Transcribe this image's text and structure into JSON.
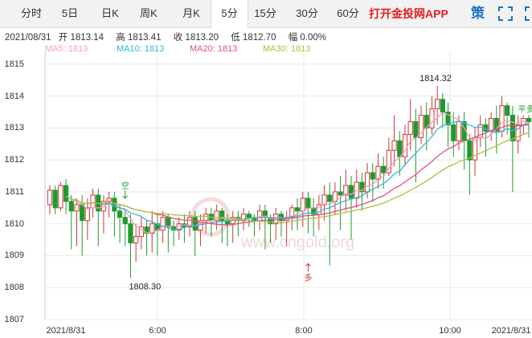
{
  "tabs": [
    {
      "label": "分时",
      "active": false
    },
    {
      "label": "5日",
      "active": false
    },
    {
      "label": "日K",
      "active": false
    },
    {
      "label": "周K",
      "active": false
    },
    {
      "label": "月K",
      "active": false
    },
    {
      "label": "5分",
      "active": true
    },
    {
      "label": "15分",
      "active": false
    },
    {
      "label": "30分",
      "active": false
    },
    {
      "label": "60分",
      "active": false
    }
  ],
  "app_link": "打开金投网APP",
  "tools": {
    "strategy_icon": "策",
    "fullscreen_icon": "expand-icon"
  },
  "ohlc": {
    "date": "2021/08/31",
    "open_label": "开",
    "open": "1813.14",
    "high_label": "高",
    "high": "1813.41",
    "close_label": "收",
    "close": "1813.20",
    "low_label": "低",
    "low": "1812.70",
    "amp_label": "幅",
    "amp": "0.00%"
  },
  "ma_legend": [
    {
      "label": "MA5: 1813",
      "color": "#f4a0b8"
    },
    {
      "label": "MA10: 1813",
      "color": "#36b7d8"
    },
    {
      "label": "MA20: 1813",
      "color": "#e0507a"
    },
    {
      "label": "MA30: 1813",
      "color": "#a9c23c"
    }
  ],
  "colors": {
    "up": "#d0373a",
    "down": "#1f9a2e",
    "grid": "#e9e9e9"
  },
  "watermark": "www.cngold.org",
  "chart_data": {
    "type": "candlestick",
    "title": "",
    "ylim": [
      1807,
      1815.3
    ],
    "y_ticks": [
      "1815",
      "1814",
      "1813",
      "1812",
      "1811",
      "1810",
      "1809",
      "1808",
      "1807"
    ],
    "x_ticks": [
      "2021/8/31",
      "6:00",
      "8:00",
      "10:00",
      "2021/8/31"
    ],
    "annotations": {
      "high": "1814.32",
      "low": "1808.30",
      "short_signal": "空",
      "long_signal": "多",
      "level_signal": "平多"
    },
    "candles": [
      [
        1810.6,
        1811.05,
        1810.3,
        1811.2
      ],
      [
        1811.05,
        1810.5,
        1810.3,
        1811.2
      ],
      [
        1810.5,
        1811.2,
        1810.4,
        1811.3
      ],
      [
        1811.2,
        1810.7,
        1810.3,
        1811.4
      ],
      [
        1810.7,
        1810.4,
        1809.2,
        1810.9
      ],
      [
        1810.4,
        1810.6,
        1809.3,
        1810.8
      ],
      [
        1810.6,
        1810.1,
        1809.0,
        1810.9
      ],
      [
        1810.1,
        1810.5,
        1809.5,
        1810.8
      ],
      [
        1810.5,
        1810.9,
        1810.2,
        1811.1
      ],
      [
        1810.9,
        1810.4,
        1809.3,
        1811.1
      ],
      [
        1810.4,
        1810.7,
        1809.7,
        1810.9
      ],
      [
        1810.7,
        1810.8,
        1810.2,
        1811.0
      ],
      [
        1810.8,
        1810.4,
        1809.6,
        1811.0
      ],
      [
        1810.4,
        1810.2,
        1809.4,
        1810.6
      ],
      [
        1810.2,
        1810.0,
        1809.3,
        1810.4
      ],
      [
        1810.0,
        1809.4,
        1808.3,
        1810.3
      ],
      [
        1809.4,
        1809.6,
        1808.8,
        1810.0
      ],
      [
        1809.6,
        1809.9,
        1809.2,
        1810.2
      ],
      [
        1809.9,
        1809.7,
        1809.0,
        1810.1
      ],
      [
        1809.7,
        1810.0,
        1809.1,
        1810.4
      ],
      [
        1810.0,
        1809.8,
        1809.0,
        1810.3
      ],
      [
        1809.8,
        1810.2,
        1809.4,
        1810.4
      ],
      [
        1810.2,
        1809.9,
        1809.1,
        1810.3
      ],
      [
        1809.9,
        1809.8,
        1809.3,
        1810.1
      ],
      [
        1809.8,
        1810.0,
        1809.5,
        1810.2
      ],
      [
        1810.0,
        1809.9,
        1809.4,
        1810.3
      ],
      [
        1809.9,
        1810.2,
        1809.6,
        1810.4
      ],
      [
        1810.2,
        1809.8,
        1809.0,
        1810.4
      ],
      [
        1809.8,
        1810.1,
        1809.3,
        1810.3
      ],
      [
        1810.1,
        1810.3,
        1809.7,
        1810.5
      ],
      [
        1810.3,
        1810.1,
        1809.6,
        1810.5
      ],
      [
        1810.1,
        1810.4,
        1809.8,
        1810.6
      ],
      [
        1810.4,
        1810.1,
        1809.4,
        1810.5
      ],
      [
        1810.1,
        1810.0,
        1809.3,
        1810.3
      ],
      [
        1810.0,
        1810.2,
        1809.4,
        1810.4
      ],
      [
        1810.2,
        1810.1,
        1809.6,
        1810.4
      ],
      [
        1810.1,
        1810.3,
        1809.8,
        1810.5
      ],
      [
        1810.3,
        1810.2,
        1809.9,
        1810.4
      ],
      [
        1810.2,
        1810.1,
        1809.6,
        1810.3
      ],
      [
        1810.1,
        1810.4,
        1809.8,
        1810.6
      ],
      [
        1810.4,
        1810.2,
        1809.2,
        1810.6
      ],
      [
        1810.2,
        1810.0,
        1809.4,
        1810.3
      ],
      [
        1810.0,
        1810.3,
        1809.5,
        1810.5
      ],
      [
        1810.3,
        1810.1,
        1809.6,
        1810.4
      ],
      [
        1810.1,
        1810.2,
        1809.3,
        1810.4
      ],
      [
        1810.2,
        1810.5,
        1809.8,
        1810.6
      ],
      [
        1810.5,
        1810.4,
        1809.8,
        1810.8
      ],
      [
        1810.4,
        1810.8,
        1809.9,
        1811.0
      ],
      [
        1810.8,
        1810.5,
        1809.7,
        1811.0
      ],
      [
        1810.5,
        1810.3,
        1809.6,
        1810.8
      ],
      [
        1810.3,
        1810.6,
        1809.8,
        1810.9
      ],
      [
        1810.6,
        1810.9,
        1810.1,
        1811.2
      ],
      [
        1810.9,
        1810.7,
        1808.7,
        1811.3
      ],
      [
        1810.7,
        1811.0,
        1810.3,
        1811.3
      ],
      [
        1811.0,
        1810.9,
        1809.8,
        1811.5
      ],
      [
        1810.9,
        1811.2,
        1810.4,
        1811.7
      ],
      [
        1811.2,
        1810.8,
        1809.5,
        1811.5
      ],
      [
        1810.8,
        1811.3,
        1810.5,
        1811.7
      ],
      [
        1811.3,
        1811.0,
        1810.4,
        1811.6
      ],
      [
        1811.0,
        1811.6,
        1810.8,
        1811.9
      ],
      [
        1811.6,
        1811.4,
        1810.7,
        1811.9
      ],
      [
        1811.4,
        1811.8,
        1811.1,
        1812.2
      ],
      [
        1811.8,
        1811.6,
        1811.1,
        1812.1
      ],
      [
        1811.6,
        1812.3,
        1811.5,
        1812.7
      ],
      [
        1812.3,
        1812.6,
        1811.8,
        1813.4
      ],
      [
        1812.6,
        1812.1,
        1811.5,
        1812.9
      ],
      [
        1812.1,
        1812.8,
        1811.8,
        1813.1
      ],
      [
        1812.8,
        1813.2,
        1812.3,
        1813.9
      ],
      [
        1813.2,
        1812.7,
        1811.3,
        1813.6
      ],
      [
        1812.7,
        1813.4,
        1812.5,
        1813.7
      ],
      [
        1813.4,
        1813.0,
        1812.3,
        1813.8
      ],
      [
        1813.0,
        1813.6,
        1812.8,
        1814.0
      ],
      [
        1813.6,
        1813.9,
        1813.1,
        1814.32
      ],
      [
        1813.9,
        1813.5,
        1813.0,
        1814.1
      ],
      [
        1813.5,
        1813.1,
        1812.4,
        1813.8
      ],
      [
        1813.1,
        1812.6,
        1812.1,
        1813.5
      ],
      [
        1812.6,
        1813.2,
        1812.3,
        1813.4
      ],
      [
        1813.2,
        1812.6,
        1811.7,
        1813.5
      ],
      [
        1812.6,
        1812.0,
        1810.9,
        1812.8
      ],
      [
        1812.0,
        1812.7,
        1811.5,
        1813.0
      ],
      [
        1812.7,
        1813.1,
        1812.4,
        1813.4
      ],
      [
        1813.1,
        1812.9,
        1812.1,
        1813.3
      ],
      [
        1812.9,
        1813.3,
        1812.6,
        1813.5
      ],
      [
        1813.3,
        1812.9,
        1812.2,
        1813.7
      ],
      [
        1812.9,
        1813.7,
        1812.7,
        1814.0
      ],
      [
        1813.7,
        1813.4,
        1812.8,
        1813.8
      ],
      [
        1813.4,
        1812.6,
        1811.0,
        1813.7
      ],
      [
        1812.6,
        1813.1,
        1812.2,
        1813.4
      ],
      [
        1813.1,
        1813.3,
        1812.8,
        1813.4
      ],
      [
        1813.3,
        1813.2,
        1812.7,
        1813.41
      ]
    ],
    "ma_series": [
      {
        "name": "MA5",
        "color": "#f4a0b8"
      },
      {
        "name": "MA10",
        "color": "#36b7d8"
      },
      {
        "name": "MA20",
        "color": "#e0507a"
      },
      {
        "name": "MA30",
        "color": "#a9c23c"
      }
    ]
  }
}
